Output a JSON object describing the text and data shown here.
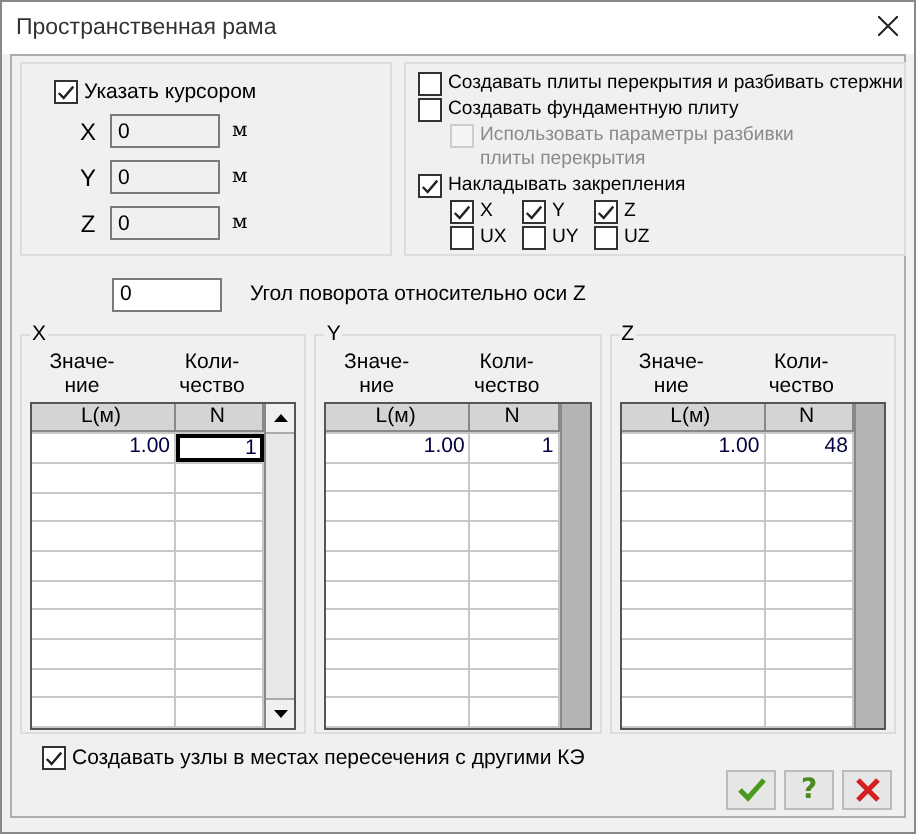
{
  "window": {
    "title": "Пространственная рама"
  },
  "cursor": {
    "label": "Указать курсором",
    "checked": true,
    "coords": [
      {
        "axis": "X",
        "value": "0",
        "unit": "м"
      },
      {
        "axis": "Y",
        "value": "0",
        "unit": "м"
      },
      {
        "axis": "Z",
        "value": "0",
        "unit": "м"
      }
    ]
  },
  "options": [
    {
      "label": "Создавать плиты перекрытия и разбивать стержни",
      "checked": false,
      "disabled": false
    },
    {
      "label": "Создавать фундаментную плиту",
      "checked": false,
      "disabled": false,
      "children": [
        {
          "kind": "option",
          "label": "Использовать параметры разбивки плиты перекрытия",
          "checked": false,
          "disabled": true
        }
      ]
    },
    {
      "label": "Накладывать закрепления",
      "checked": true,
      "disabled": false,
      "children": [
        {
          "kind": "axis",
          "label": "X",
          "checked": true,
          "disabled": false
        },
        {
          "kind": "axis",
          "label": "Y",
          "checked": true,
          "disabled": false
        },
        {
          "kind": "axis",
          "label": "Z",
          "checked": true,
          "disabled": false
        },
        {
          "kind": "axis",
          "label": "UX",
          "checked": false,
          "disabled": false
        },
        {
          "kind": "axis",
          "label": "UY",
          "checked": false,
          "disabled": false
        },
        {
          "kind": "axis",
          "label": "UZ",
          "checked": false,
          "disabled": false
        }
      ]
    }
  ],
  "rotation": {
    "value": "0",
    "label": "Угол поворота относительно оси Z"
  },
  "tables": [
    {
      "title": "X",
      "headers": [
        "Значе-\nние",
        "Коли-\nчество"
      ],
      "columns": [
        "L(м)",
        "N"
      ],
      "scrollable": true,
      "rows": [
        {
          "cells": [
            {
              "text": "1.00",
              "selected": false
            },
            {
              "text": "1",
              "selected": true
            }
          ]
        }
      ]
    },
    {
      "title": "Y",
      "headers": [
        "Значе-\nние",
        "Коли-\nчество"
      ],
      "columns": [
        "L(м)",
        "N"
      ],
      "scrollable": false,
      "rows": [
        {
          "cells": [
            {
              "text": "1.00",
              "selected": false
            },
            {
              "text": "1",
              "selected": false
            }
          ]
        }
      ]
    },
    {
      "title": "Z",
      "headers": [
        "Значе-\nние",
        "Коли-\nчество"
      ],
      "columns": [
        "L(м)",
        "N"
      ],
      "scrollable": false,
      "rows": [
        {
          "cells": [
            {
              "text": "1.00",
              "selected": false
            },
            {
              "text": "48",
              "selected": false
            }
          ]
        }
      ]
    }
  ],
  "intersection_nodes": {
    "label": "Создавать узлы в местах пересечения с другими КЭ",
    "checked": true
  },
  "buttons": [
    {
      "kind": "ok"
    },
    {
      "kind": "help",
      "label": "?"
    },
    {
      "kind": "cancel"
    }
  ]
}
